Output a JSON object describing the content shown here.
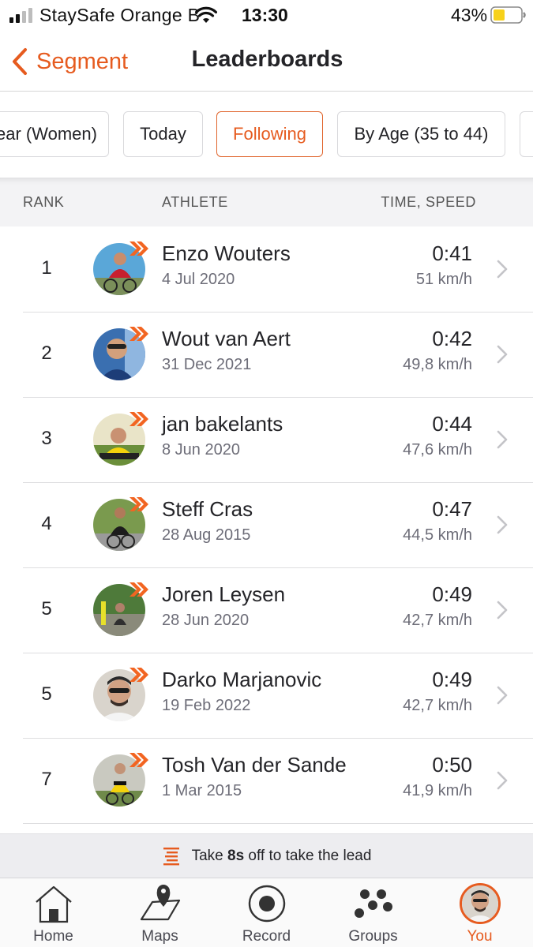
{
  "status_bar": {
    "carrier": "StaySafe Orange B",
    "time": "13:30",
    "battery": "43%"
  },
  "nav": {
    "back_label": "Segment",
    "title": "Leaderboards"
  },
  "filters": [
    {
      "label": "ear (Women)",
      "active": false
    },
    {
      "label": "Today",
      "active": false
    },
    {
      "label": "Following",
      "active": true
    },
    {
      "label": "By Age (35 to 44)",
      "active": false
    }
  ],
  "table": {
    "headers": {
      "rank": "RANK",
      "athlete": "ATHLETE",
      "time": "TIME, SPEED"
    },
    "rows": [
      {
        "rank": "1",
        "name": "Enzo Wouters",
        "date": "4 Jul 2020",
        "time": "0:41",
        "speed": "51 km/h"
      },
      {
        "rank": "2",
        "name": "Wout van Aert",
        "date": "31 Dec 2021",
        "time": "0:42",
        "speed": "49,8 km/h"
      },
      {
        "rank": "3",
        "name": "jan bakelants",
        "date": "8 Jun 2020",
        "time": "0:44",
        "speed": "47,6 km/h"
      },
      {
        "rank": "4",
        "name": "Steff Cras",
        "date": "28 Aug 2015",
        "time": "0:47",
        "speed": "44,5 km/h"
      },
      {
        "rank": "5",
        "name": "Joren Leysen",
        "date": "28 Jun 2020",
        "time": "0:49",
        "speed": "42,7 km/h"
      },
      {
        "rank": "5",
        "name": "Darko Marjanovic",
        "date": "19 Feb 2022",
        "time": "0:49",
        "speed": "42,7 km/h"
      },
      {
        "rank": "7",
        "name": "Tosh Van der Sande",
        "date": "1 Mar 2015",
        "time": "0:50",
        "speed": "41,9 km/h"
      }
    ]
  },
  "lead_banner": {
    "prefix": "Take",
    "amount": "8s",
    "suffix": "off to take the lead"
  },
  "tabs": [
    {
      "label": "Home",
      "icon": "home-icon"
    },
    {
      "label": "Maps",
      "icon": "map-icon"
    },
    {
      "label": "Record",
      "icon": "record-icon"
    },
    {
      "label": "Groups",
      "icon": "groups-icon"
    },
    {
      "label": "You",
      "icon": "profile-avatar",
      "active": true
    }
  ],
  "colors": {
    "accent": "#e65b1f",
    "badge": "#f26522",
    "header_bg": "#f3f3f5",
    "banner_bg": "#ededf0"
  }
}
